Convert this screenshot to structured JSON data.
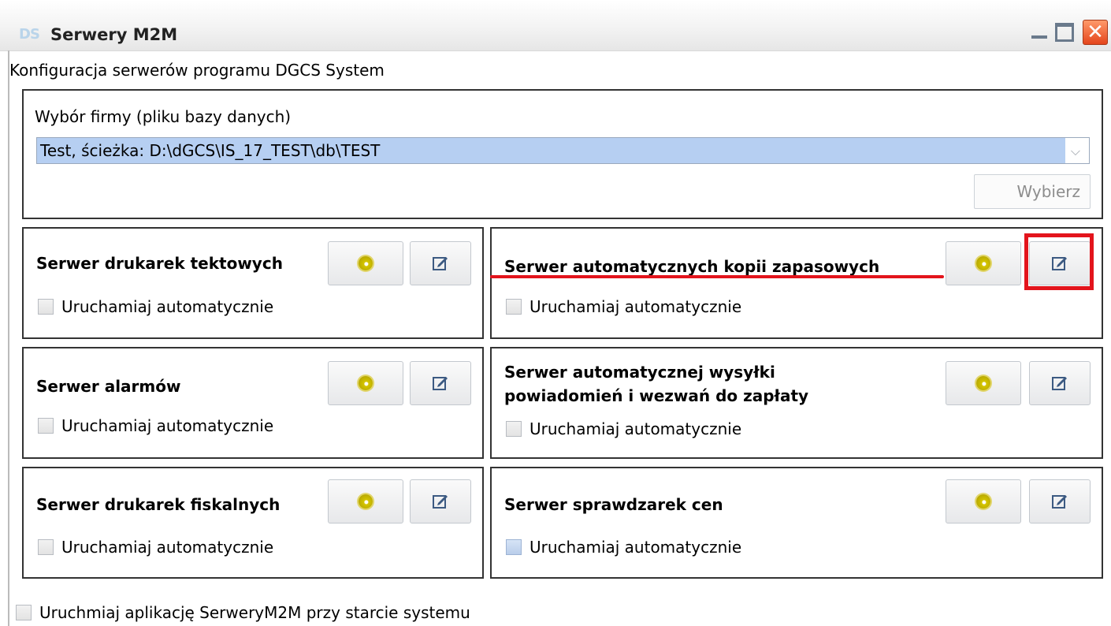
{
  "window": {
    "title": "Serwery M2M",
    "logo_text": "DS",
    "minimize_icon": "minimize-icon",
    "maximize_icon": "maximize-icon",
    "close_icon": "close-icon",
    "close_glyph": "✕"
  },
  "subtitle": "Konfiguracja serwerów programu DGCS System",
  "firm_selection": {
    "label": "Wybór firmy (pliku bazy danych)",
    "selected_value": "Test, ścieżka: D:\\dGCS\\IS_17_TEST\\db\\TEST",
    "dropdown_arrow": "⌵",
    "choose_button": "Wybierz"
  },
  "auto_start_label": "Uruchamiaj automatycznie",
  "servers": [
    {
      "title": "Serwer drukarek tektowych",
      "auto_start": false
    },
    {
      "title": "Serwer automatycznych kopii zapasowych",
      "auto_start": false
    },
    {
      "title": "Serwer alarmów",
      "auto_start": false
    },
    {
      "title_line1": "Serwer automatycznej wysyłki",
      "title_line2": "powiadomień i wezwań do zapłaty",
      "auto_start": false
    },
    {
      "title": "Serwer drukarek fiskalnych",
      "auto_start": false
    },
    {
      "title": "Serwer sprawdzarek cen",
      "auto_start": false
    }
  ],
  "bottom_option": "Uruchmiaj aplikację SerweryM2M przy starcie systemu",
  "colors": {
    "highlight_red": "#e3141c",
    "selection_blue": "#b6cff2",
    "start_indicator": "#d4c400"
  }
}
